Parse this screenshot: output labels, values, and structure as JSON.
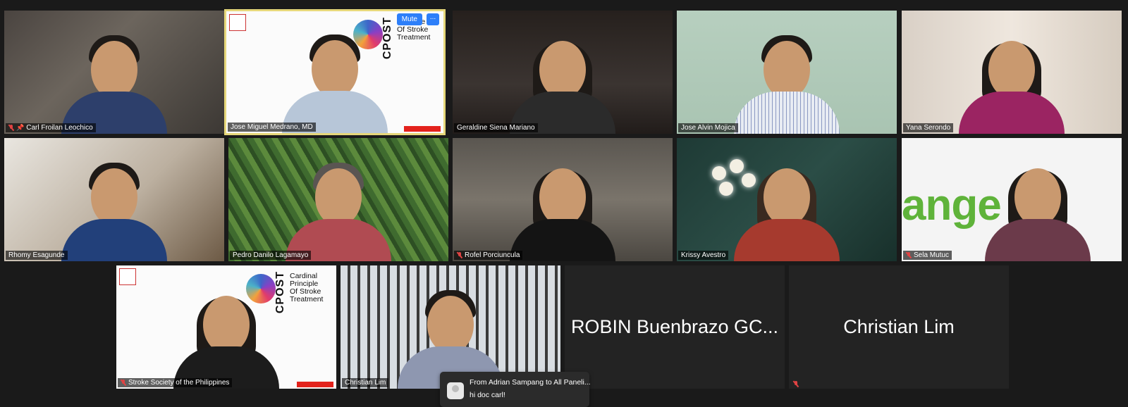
{
  "participants": [
    {
      "name": "Carl Froilan Leochico",
      "muted": true,
      "pinned": true
    },
    {
      "name": "Jose Miguel Medrano, MD",
      "active_speaker": true,
      "logo": {
        "mark": "CPOST",
        "text": "Principle\nOf Stroke\nTreatment"
      }
    },
    {
      "name": "Geraldine Siena Mariano"
    },
    {
      "name": "Jose Alvin Mojica"
    },
    {
      "name": "Yana Serondo"
    },
    {
      "name": "Rhomy Esagunde"
    },
    {
      "name": "Pedro Danilo Lagamayo"
    },
    {
      "name": "Rofel Porciuncula",
      "muted": true
    },
    {
      "name": "Krissy Avestro"
    },
    {
      "name": "Sela Mutuc",
      "muted": true,
      "brand_text": "ange"
    },
    {
      "name": "Stroke Society of the Philippines",
      "muted": true,
      "logo": {
        "mark": "CPOST",
        "text": "Cardinal\nPrinciple\nOf Stroke\nTreatment"
      }
    },
    {
      "name": "Christian Lim"
    },
    {
      "display_name": "ROBIN Buenbrazo GC..."
    },
    {
      "display_name": "Christian Lim",
      "muted": true
    }
  ],
  "active_tile_controls": {
    "mute_label": "Mute",
    "more_label": "..."
  },
  "chat_notification": {
    "from": "From Adrian Sampang to All Paneli...",
    "message": "hi doc carl!"
  }
}
